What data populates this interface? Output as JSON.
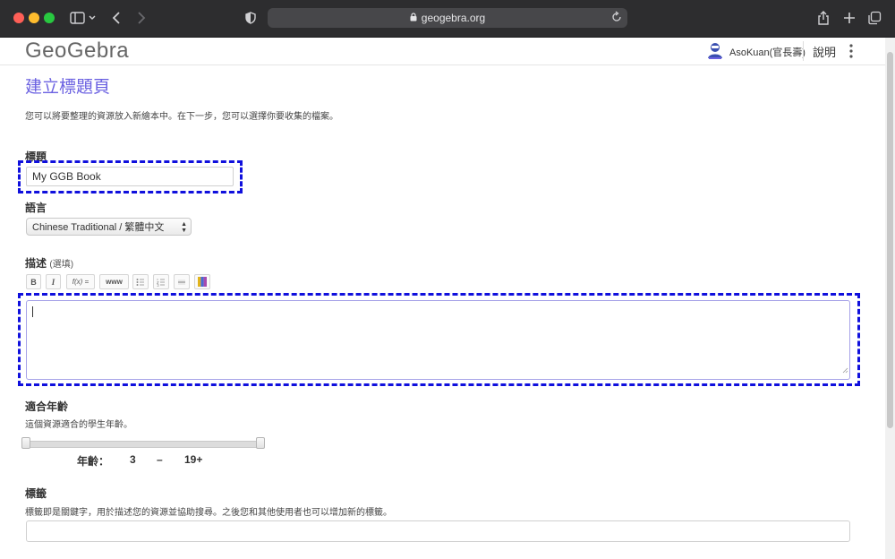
{
  "browser": {
    "url": "geogebra.org"
  },
  "header": {
    "logo": "GeoGebra",
    "user_name": "AsoKuan(官長壽)",
    "help_label": "說明"
  },
  "page": {
    "title": "建立標題頁",
    "intro": "您可以將要整理的資源放入新繪本中。在下一步，您可以選擇你要收集的檔案。"
  },
  "form": {
    "title_label": "標題",
    "title_value": "My GGB Book",
    "language_label": "語言",
    "language_value": "Chinese Traditional / 繁體中文",
    "description_label": "描述",
    "description_optional": "(選填)",
    "toolbar": {
      "bold": "B",
      "italic": "I",
      "formula": "f(x) =",
      "link": "www"
    },
    "description_value": "",
    "age_label": "適合年齡",
    "age_hint": "這個資源適合的學生年齡。",
    "age_prefix": "年齡：",
    "age_min": "3",
    "age_dash": "–",
    "age_max": "19+",
    "age_range": {
      "min": 3,
      "max": 19,
      "selected_min": 3,
      "selected_max": 19
    },
    "tags_label": "標籤",
    "tags_hint": "標籤即是關鍵字，用於描述您的資源並協助搜尋。之後您和其他使用者也可以增加新的標籤。",
    "tags_value": ""
  },
  "colors": {
    "accent": "#6b61e1",
    "highlight": "#1010dd"
  }
}
